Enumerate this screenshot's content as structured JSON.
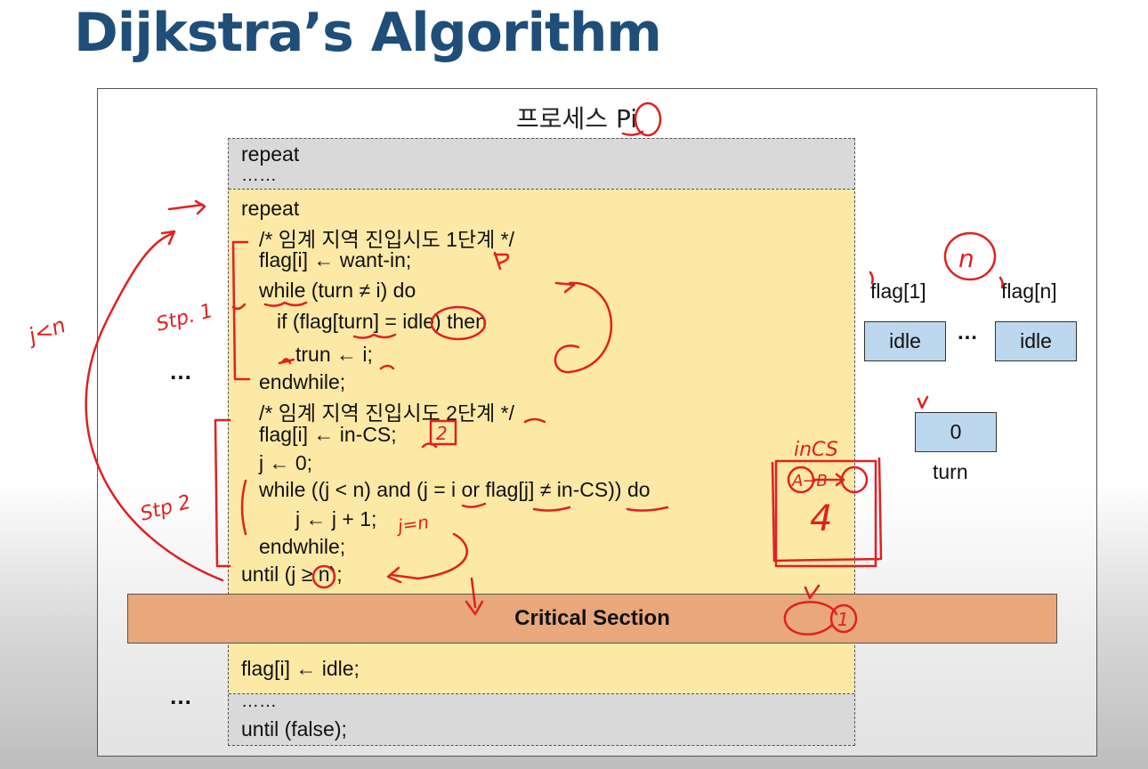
{
  "title": "Dijkstra’s Algorithm",
  "process_label": "프로세스 Pi",
  "outer": {
    "repeat": "repeat",
    "dots_top": "……",
    "dots_bottom": "……",
    "until_false": "until (false);"
  },
  "code": {
    "line1": "repeat",
    "line2": "/* 임계 지역 진입시도 1단계 */",
    "line3": "flag[i] ← want-in;",
    "line4": "while (turn ≠ i) do",
    "line5": "if (flag[turn] = idle) then",
    "line6": "trun ← i;",
    "line7": "endwhile;",
    "line8": "/* 임계 지역 진입시도 2단계 */",
    "line9": "flag[i] ← in-CS;",
    "line10": "j ← 0;",
    "line11": "while ((j < n) and (j = i or flag[j] ≠ in-CS)) do",
    "line12": "j ← j + 1;",
    "line13": "endwhile;",
    "line14": "until (j ≥ n);",
    "line_after_cs": "flag[i] ← idle;"
  },
  "critical_section": "Critical Section",
  "side_dots": "…",
  "flags": {
    "flag1_label": "flag[1]",
    "flagn_label": "flag[n]",
    "flag1_value": "idle",
    "flagn_value": "idle",
    "ellipsis": "…"
  },
  "turn": {
    "value": "0",
    "label": "turn"
  },
  "handwriting": {
    "step1": "Stp. 1",
    "step2": "Stp 2",
    "jn": "j<n",
    "n_mark": "n",
    "incs": "inCS",
    "ab": "A→B",
    "four": "4",
    "one": "1",
    "two": "2",
    "jn2": "j=n"
  },
  "colors": {
    "title": "#1f4e79",
    "inner_box": "#fde9a6",
    "outer_box": "#d9d9d9",
    "critical_section": "#e8a87c",
    "cell": "#bdd7ee",
    "ink": "#e02020"
  }
}
